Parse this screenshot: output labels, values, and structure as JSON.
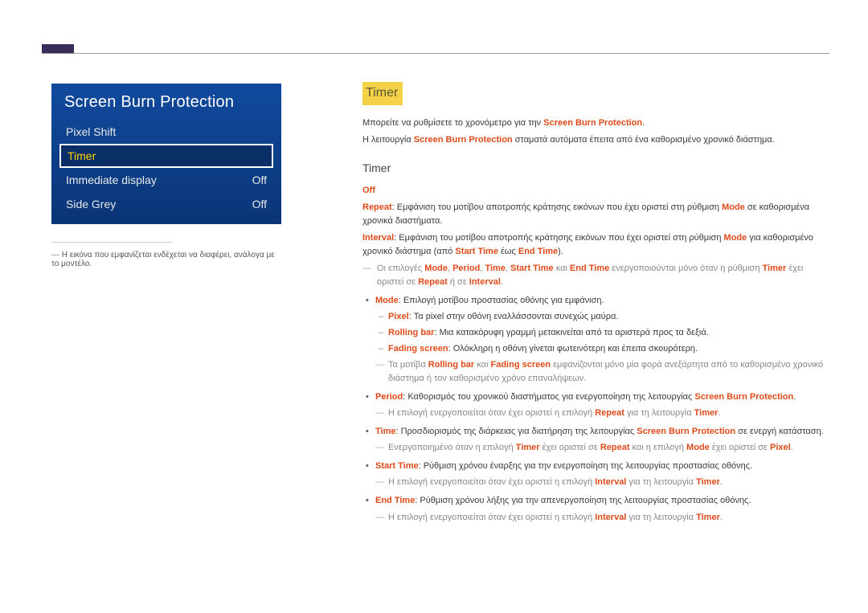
{
  "menu": {
    "title": "Screen Burn Protection",
    "items": [
      {
        "label": "Pixel Shift",
        "value": ""
      },
      {
        "label": "Timer",
        "value": "",
        "selected": true
      },
      {
        "label": "Immediate display",
        "value": "Off"
      },
      {
        "label": "Side Grey",
        "value": "Off"
      }
    ],
    "caption": "Η εικόνα που εμφανίζεται ενδέχεται να διαφέρει, ανάλογα με το μοντέλο."
  },
  "content": {
    "heading_main": "Timer",
    "intro1_a": "Μπορείτε να ρυθμίσετε το χρονόμετρο για την ",
    "intro1_kw": "Screen Burn Protection",
    "intro1_b": ".",
    "intro2_a": "Η λειτουργία ",
    "intro2_kw": "Screen Burn Protection",
    "intro2_b": " σταματά αυτόματα έπειτα από ένα καθορισμένο χρονικό διάστημα.",
    "heading_sub": "Timer",
    "off": "Off",
    "repeat_kw": "Repeat",
    "repeat_a": ": Εμφάνιση του μοτίβου αποτροπής κράτησης εικόνων που έχει οριστεί στη ρύθμιση ",
    "repeat_mode_kw": "Mode",
    "repeat_b": " σε καθορισμένα χρονικά διαστήματα.",
    "interval_kw": "Interval",
    "interval_a": ": Εμφάνιση του μοτίβου αποτροπής κράτησης εικόνων που έχει οριστεί στη ρύθμιση ",
    "interval_mode_kw": "Mode",
    "interval_b": " για καθορισμένο χρονικό διάστημα (από ",
    "interval_start_kw": "Start Time",
    "interval_c": " έως ",
    "interval_end_kw": "End Time",
    "interval_d": ").",
    "note1_a": "Οι επιλογές ",
    "note1_kw1": "Mode",
    "note1_s1": ", ",
    "note1_kw2": "Period",
    "note1_s2": ", ",
    "note1_kw3": "Time",
    "note1_s3": ", ",
    "note1_kw4": "Start Time",
    "note1_s4": " και ",
    "note1_kw5": "End Time",
    "note1_b": " ενεργοποιούνται μόνο όταν η ρύθμιση ",
    "note1_kw6": "Timer",
    "note1_c": " έχει οριστεί σε ",
    "note1_kw7": "Repeat",
    "note1_d": " ή σε ",
    "note1_kw8": "Interval",
    "note1_e": ".",
    "mode_kw": "Mode",
    "mode_txt": ": Επιλογή μοτίβου προστασίας οθόνης για εμφάνιση.",
    "pixel_kw": "Pixel",
    "pixel_txt": ": Τα pixel στην οθόνη εναλλάσσονται συνεχώς μαύρα.",
    "rolling_kw": "Rolling bar",
    "rolling_txt": ": Μια κατακόρυφη γραμμή μετακινείται από τα αριστερά προς τα δεξιά.",
    "fading_kw": "Fading screen",
    "fading_txt": ": Ολόκληρη η οθόνη γίνεται φωτεινότερη και έπειτα σκουρότερη.",
    "note2_a": "Τα μοτίβα ",
    "note2_kw1": "Rolling bar",
    "note2_b": " και ",
    "note2_kw2": "Fading screen",
    "note2_c": " εμφανίζονται μόνο μία φορά ανεξάρτητα από το καθορισμένο χρονικό διάστημα ή τον καθορισμένο χρόνο επαναλήψεων.",
    "period_kw": "Period",
    "period_a": ": Καθορισμός του χρονικού διαστήματος για ενεργοποίηση της λειτουργίας ",
    "period_kw2": "Screen Burn Protection",
    "period_b": ".",
    "period_note_a": "Η επιλογή ενεργοποιείται όταν έχει οριστεί η επιλογή ",
    "period_note_kw1": "Repeat",
    "period_note_b": " για τη λειτουργία ",
    "period_note_kw2": "Timer",
    "period_note_c": ".",
    "time_kw": "Time",
    "time_a": ": Προσδιορισμός της διάρκειας για διατήρηση της λειτουργίας ",
    "time_kw2": "Screen Burn Protection",
    "time_b": " σε ενεργή κατάσταση.",
    "time_note_a": "Ενεργοποιημένο όταν η επιλογή ",
    "time_note_kw1": "Timer",
    "time_note_b": " έχει οριστεί σε ",
    "time_note_kw2": "Repeat",
    "time_note_c": " και η επιλογή ",
    "time_note_kw3": "Mode",
    "time_note_d": " έχει οριστεί σε ",
    "time_note_kw4": "Pixel",
    "time_note_e": ".",
    "start_kw": "Start Time",
    "start_txt": ": Ρύθμιση χρόνου έναρξης για την ενεργοποίηση της λειτουργίας προστασίας οθόνης.",
    "start_note_a": "Η επιλογή ενεργοποιείται όταν έχει οριστεί η επιλογή ",
    "start_note_kw1": "Interval",
    "start_note_b": " για τη λειτουργία ",
    "start_note_kw2": "Timer",
    "start_note_c": ".",
    "end_kw": "End Time",
    "end_txt": ": Ρύθμιση χρόνου λήξης για την απενεργοποίηση της λειτουργίας προστασίας οθόνης.",
    "end_note_a": "Η επιλογή ενεργοποιείται όταν έχει οριστεί η επιλογή ",
    "end_note_kw1": "Interval",
    "end_note_b": " για τη λειτουργία ",
    "end_note_kw2": "Timer",
    "end_note_c": "."
  }
}
